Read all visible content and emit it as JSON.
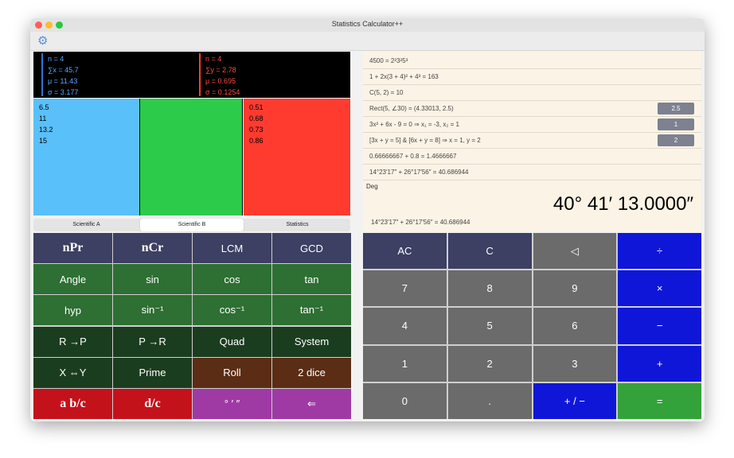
{
  "window": {
    "title": "Statistics Calculator++"
  },
  "toolbar": {
    "icon": "gear-icon",
    "glyph": "⚙"
  },
  "stats": {
    "x": {
      "n": "n = 4",
      "sum": "∑x = 45.7",
      "mean": "μ = 11.43",
      "sd": "σ = 3.177"
    },
    "y": {
      "n": "n = 4",
      "sum": "∑y = 2.78",
      "mean": "μ = 0.695",
      "sd": "σ = 0.1254"
    }
  },
  "columns": {
    "blue": [
      "6.5",
      "11",
      "13.2",
      "15"
    ],
    "green": [],
    "red": [
      "0.51",
      "0.68",
      "0.73",
      "0.86"
    ]
  },
  "tabs": [
    "Scientific A",
    "Scientific B",
    "Statistics"
  ],
  "left_keys": [
    {
      "label": "nPr",
      "color": "navy",
      "serif": true
    },
    {
      "label": "nCr",
      "color": "navy",
      "serif": true
    },
    {
      "label": "LCM",
      "color": "navy"
    },
    {
      "label": "GCD",
      "color": "navy"
    },
    {
      "label": "Angle",
      "color": "green"
    },
    {
      "label": "sin",
      "color": "green"
    },
    {
      "label": "cos",
      "color": "green"
    },
    {
      "label": "tan",
      "color": "green"
    },
    {
      "label": "hyp",
      "color": "green"
    },
    {
      "label": "sin⁻¹",
      "color": "green"
    },
    {
      "label": "cos⁻¹",
      "color": "green"
    },
    {
      "label": "tan⁻¹",
      "color": "green"
    },
    {
      "label": "R →P",
      "color": "dkgreen"
    },
    {
      "label": "P →R",
      "color": "dkgreen"
    },
    {
      "label": "Quad",
      "color": "dkgreen"
    },
    {
      "label": "System",
      "color": "dkgreen"
    },
    {
      "label": "X ⇔Y",
      "color": "dkgreen"
    },
    {
      "label": "Prime",
      "color": "dkgreen"
    },
    {
      "label": "Roll",
      "color": "brown"
    },
    {
      "label": "2 dice",
      "color": "brown"
    },
    {
      "label": "a b/c",
      "color": "crimson",
      "serif": true
    },
    {
      "label": "d/c",
      "color": "crimson",
      "serif": true
    },
    {
      "label": "° ′ ″",
      "color": "purple"
    },
    {
      "label": "⇐",
      "color": "purple"
    }
  ],
  "history": [
    {
      "text": "4500 = 2²3²5³",
      "btn": ""
    },
    {
      "text": "1 + 2x(3 + 4)² + 4³ = 163",
      "btn": ""
    },
    {
      "text": "C(5, 2) = 10",
      "btn": ""
    },
    {
      "text": "Rect(5, ∠30) = (4.33013, 2.5)",
      "btn": "2.5"
    },
    {
      "text": "3x² + 6x - 9 = 0     ⇒     x₁ = -3, x₂ = 1",
      "btn": "1"
    },
    {
      "text": "[3x + y = 5]  &  [6x + y = 8] ⇒ x = 1, y = 2",
      "btn": "2"
    },
    {
      "text": "0.66666667 + 0.8 = 1.4666667",
      "btn": ""
    },
    {
      "text": "14°23′17″ + 26°17′56″ = 40.686944",
      "btn": ""
    }
  ],
  "display": {
    "mode": "Deg",
    "result": "40° 41′ 13.0000″",
    "expression": "14°23′17″ + 26°17′56″ = 40.686944"
  },
  "right_keys": [
    {
      "label": "AC",
      "color": "dark"
    },
    {
      "label": "C",
      "color": "dark"
    },
    {
      "label": "◁",
      "color": "gray"
    },
    {
      "label": "÷",
      "color": "blue"
    },
    {
      "label": "7",
      "color": "gray"
    },
    {
      "label": "8",
      "color": "gray"
    },
    {
      "label": "9",
      "color": "gray"
    },
    {
      "label": "×",
      "color": "blue"
    },
    {
      "label": "4",
      "color": "gray"
    },
    {
      "label": "5",
      "color": "gray"
    },
    {
      "label": "6",
      "color": "gray"
    },
    {
      "label": "−",
      "color": "blue"
    },
    {
      "label": "1",
      "color": "gray"
    },
    {
      "label": "2",
      "color": "gray"
    },
    {
      "label": "3",
      "color": "gray"
    },
    {
      "label": "+",
      "color": "blue"
    },
    {
      "label": "0",
      "color": "gray"
    },
    {
      "label": ".",
      "color": "gray"
    },
    {
      "label": "+ / −",
      "color": "blue"
    },
    {
      "label": "=",
      "color": "emerald"
    }
  ]
}
